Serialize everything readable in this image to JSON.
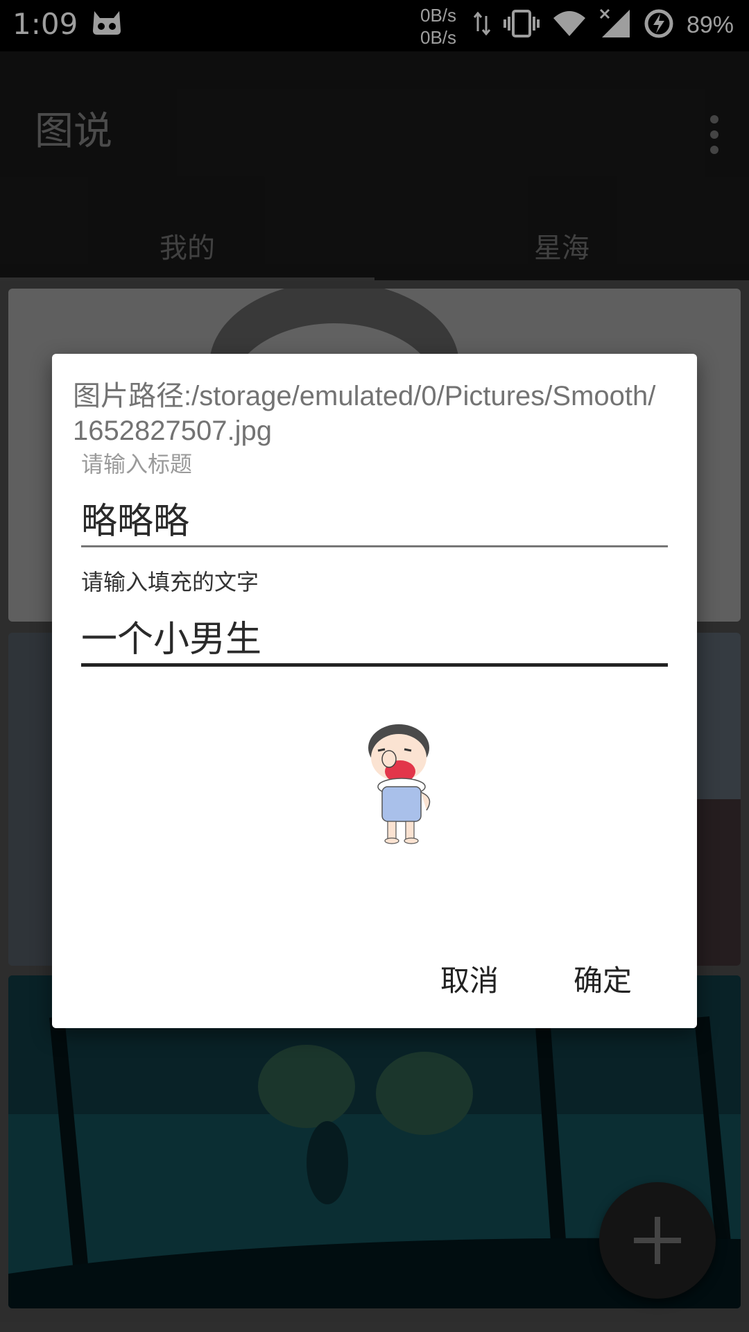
{
  "status_bar": {
    "time": "1:09",
    "net_speed_up": "0B/s",
    "net_speed_down": "0B/s",
    "battery": "89%"
  },
  "app_bar": {
    "title": "图说"
  },
  "tabs": [
    {
      "label": "我的",
      "selected": true
    },
    {
      "label": "星海",
      "selected": false
    }
  ],
  "dialog": {
    "path_text": "图片路径:/storage/emulated/0/Pictures/Smooth/1652827507.jpg",
    "title_field": {
      "label": "请输入标题",
      "value": "略略略"
    },
    "fill_field": {
      "label": "请输入填充的文字",
      "value": "一个小男生"
    },
    "cancel_label": "取消",
    "confirm_label": "确定"
  },
  "colors": {
    "status_bar": "#000000",
    "app_bar": "#181818",
    "dialog_bg": "#ffffff",
    "fab": "#141414"
  }
}
